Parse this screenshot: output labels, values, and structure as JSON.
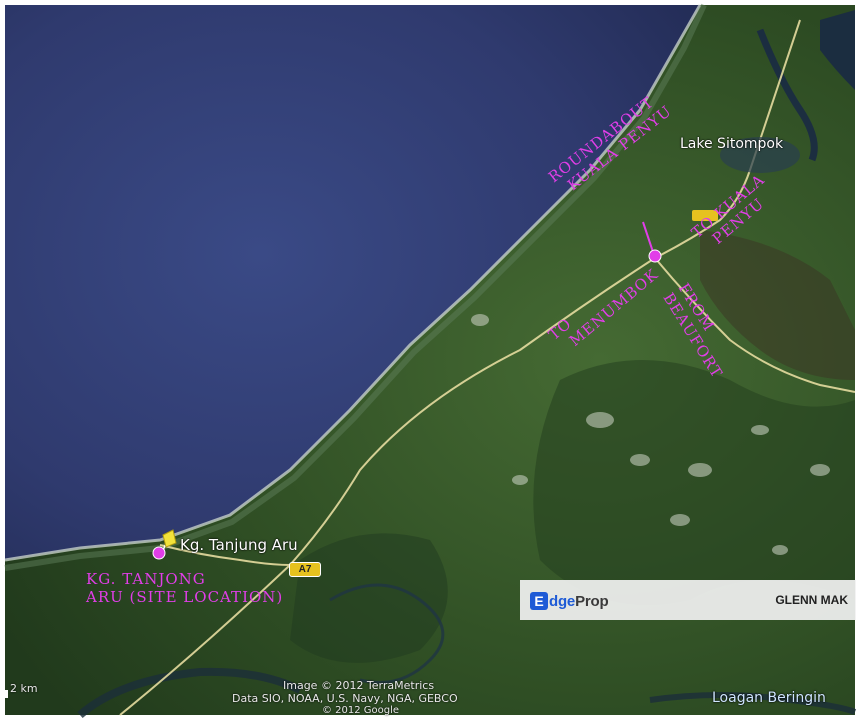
{
  "map": {
    "places": {
      "lake": "Lake Sitompok",
      "village": "Kg. Tanjung Aru",
      "bottom_right": "Loagan Beringin"
    },
    "route_shield": "A7",
    "annotations": {
      "roundabout_line1": "ROUNDABOUT",
      "roundabout_line2": "KUALA PENYU",
      "to_kuala_line1": "TO KUALA",
      "to_kuala_line2": "PENYU",
      "to_menumbok_line1": "TO",
      "to_menumbok_line2": "MENUMBOK",
      "from_beaufort_line1": "FROM",
      "from_beaufort_line2": "BEAUFORT",
      "site_line1": "KG. TANJONG",
      "site_line2": "ARU (SITE LOCATION)"
    },
    "scale_label": "2 km",
    "attribution": {
      "line1": "Image © 2012 TerraMetrics",
      "line2": "Data SIO, NOAA, U.S. Navy, NGA, GEBCO",
      "line3": "© 2012 Google"
    }
  },
  "watermark": {
    "brand_badge": "E",
    "brand_edge": "dge",
    "brand_prop": "Prop",
    "agent_name": "GLENN MAK"
  },
  "colors": {
    "sea": "#2e3a6a",
    "land": "#3b5a2c",
    "annotation": "#e13ee8",
    "brand": "#1e5bd6"
  }
}
